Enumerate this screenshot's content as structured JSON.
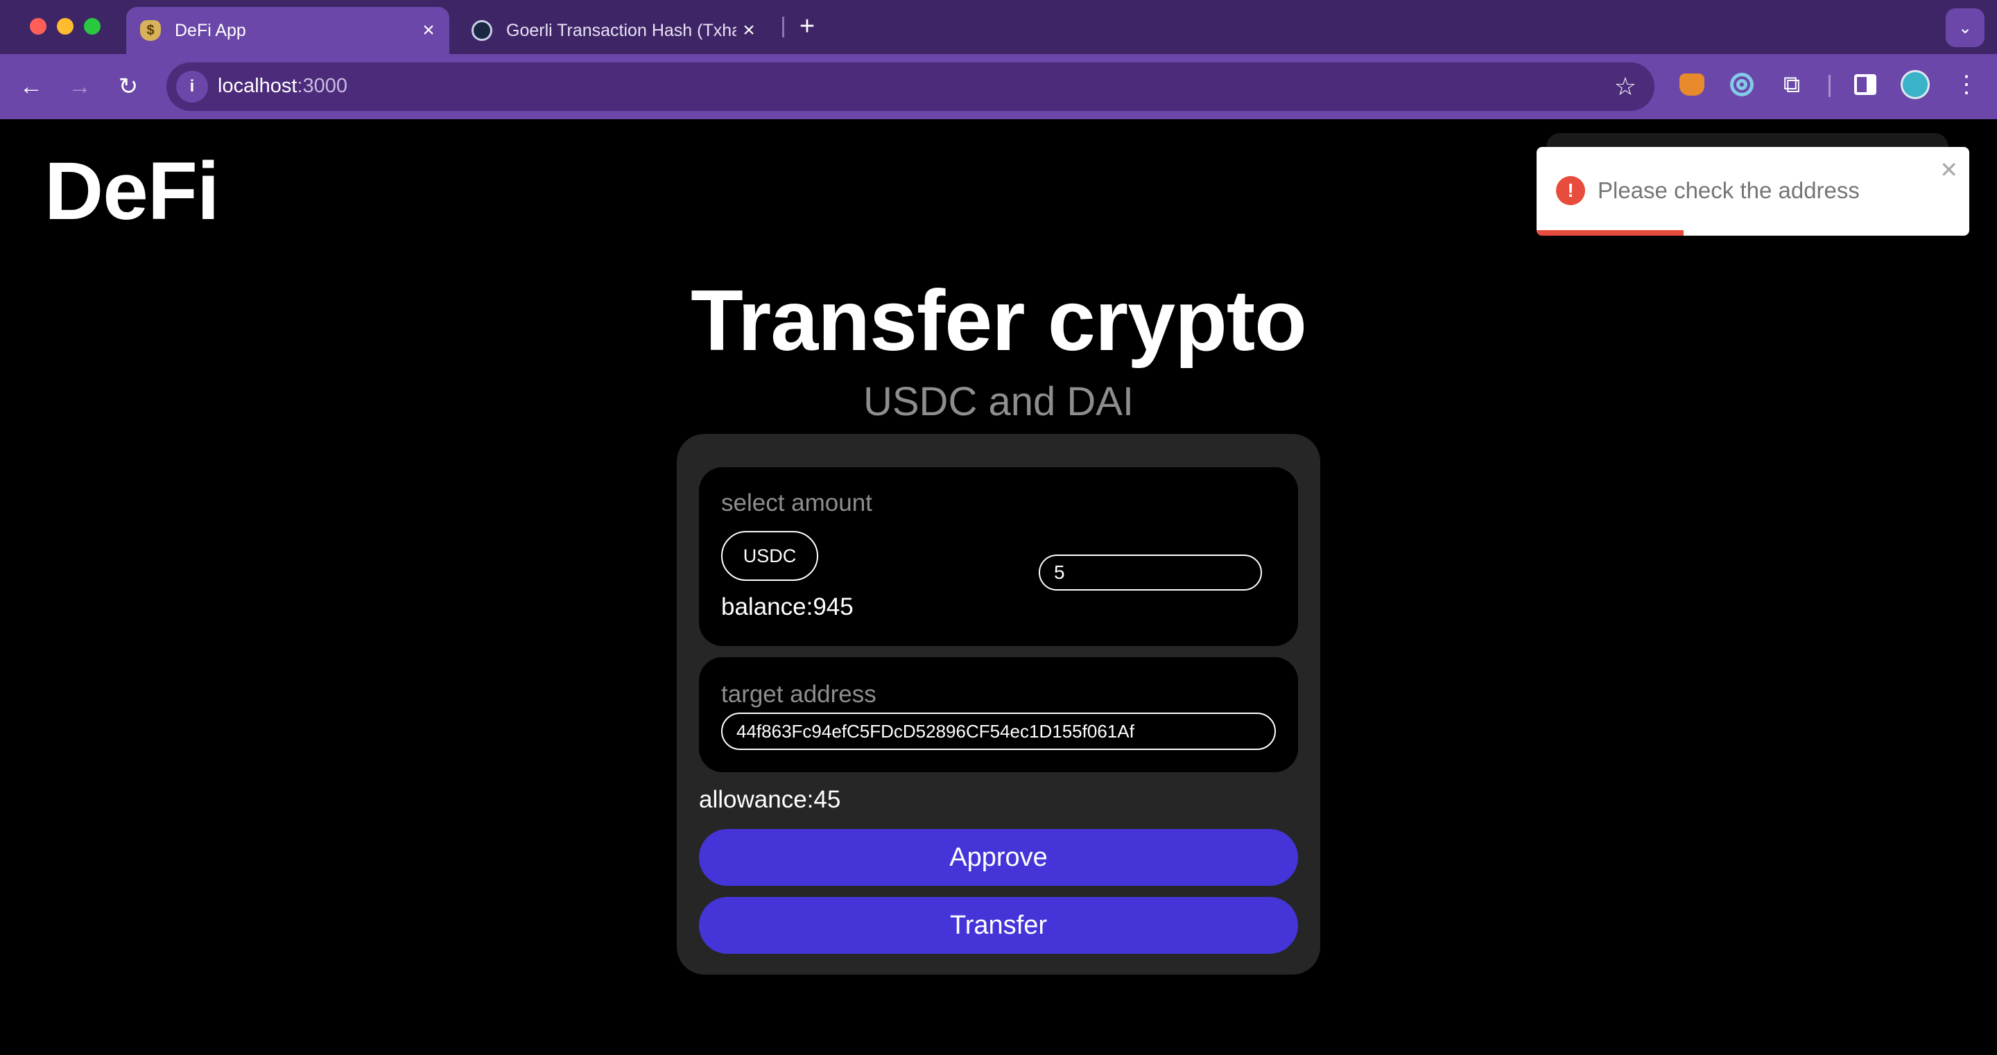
{
  "browser": {
    "tabs": [
      {
        "title": "DeFi App",
        "active": true,
        "icon": "moneybag-icon"
      },
      {
        "title": "Goerli Transaction Hash (Txha",
        "active": false,
        "icon": "ethereum-icon"
      }
    ],
    "url": {
      "host": "localhost",
      "port": ":3000"
    }
  },
  "app": {
    "logo": "DeFi",
    "title": "Transfer crypto",
    "subtitle": "USDC and DAI"
  },
  "form": {
    "amount_label": "select amount",
    "token": "USDC",
    "amount_value": "5",
    "balance": "balance:945",
    "target_label": "target address",
    "address_value": "44f863Fc94efC5FDcD52896CF54ec1D155f061Af",
    "allowance": "allowance:45",
    "approve_label": "Approve",
    "transfer_label": "Transfer"
  },
  "toast": {
    "message": "Please check the address",
    "type": "error",
    "progress": 0.34,
    "accent": "#e74c3c"
  },
  "colors": {
    "brand": "#4535d9",
    "browser_chrome": "#6a47a8"
  }
}
